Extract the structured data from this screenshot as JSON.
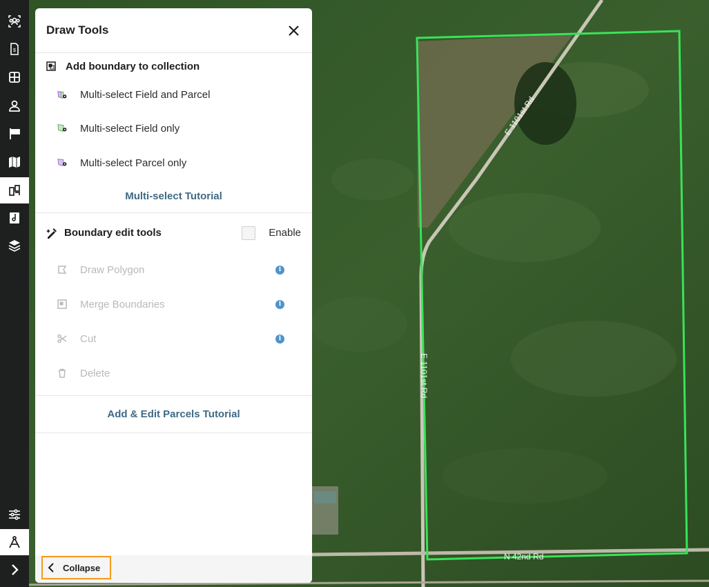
{
  "panel": {
    "title": "Draw Tools",
    "collection_section": {
      "heading": "Add boundary to collection",
      "items": [
        {
          "label": "Multi-select Field and Parcel"
        },
        {
          "label": "Multi-select Field only"
        },
        {
          "label": "Multi-select Parcel only"
        }
      ],
      "tutorial_link": "Multi-select Tutorial"
    },
    "boundary_section": {
      "heading": "Boundary edit tools",
      "enable_label": "Enable",
      "enabled": false,
      "items": [
        {
          "label": "Draw Polygon",
          "info": "i"
        },
        {
          "label": "Merge Boundaries",
          "info": "i"
        },
        {
          "label": "Cut",
          "info": "i"
        },
        {
          "label": "Delete"
        }
      ],
      "tutorial_link": "Add & Edit Parcels Tutorial"
    },
    "collapse_label": "Collapse"
  },
  "map": {
    "road_labels": [
      "E 1101st Rd",
      "E 1101st Rd",
      "N 42nd Rd"
    ],
    "boundary_color": "#39e35a"
  },
  "colors": {
    "rail_bg": "#1e1f1f",
    "link": "#3f6a85",
    "info": "#4f93c9",
    "highlight": "#f39a1c"
  }
}
